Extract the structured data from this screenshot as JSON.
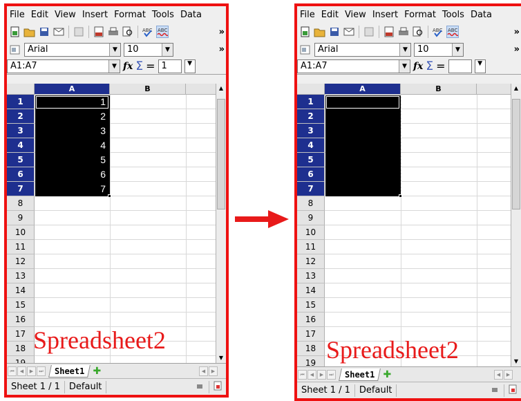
{
  "menu": [
    "File",
    "Edit",
    "View",
    "Insert",
    "Format",
    "Tools",
    "Data"
  ],
  "font_name": "Arial",
  "font_size": "10",
  "left": {
    "name_box": "A1:A7",
    "formula_value": "1",
    "col_a": "A",
    "col_b": "B",
    "values": [
      "1",
      "2",
      "3",
      "4",
      "5",
      "6",
      "7"
    ],
    "sheet_tab": "Sheet1",
    "status_sheet": "Sheet 1 / 1",
    "status_style": "Default",
    "overlay_label": "Spreadsheet2"
  },
  "right": {
    "name_box": "A1:A7",
    "formula_value": "",
    "col_a": "A",
    "col_b": "B",
    "sheet_tab": "Sheet1",
    "status_sheet": "Sheet 1 / 1",
    "status_style": "Default",
    "overlay_label": "Spreadsheet2"
  },
  "rows": [
    "1",
    "2",
    "3",
    "4",
    "5",
    "6",
    "7",
    "8",
    "9",
    "10",
    "11",
    "12",
    "13",
    "14",
    "15",
    "16",
    "17",
    "18",
    "19"
  ],
  "colors": {
    "frame": "#ee1111",
    "selection_header": "#1e2f8f",
    "arrow": "#e81a1a"
  }
}
